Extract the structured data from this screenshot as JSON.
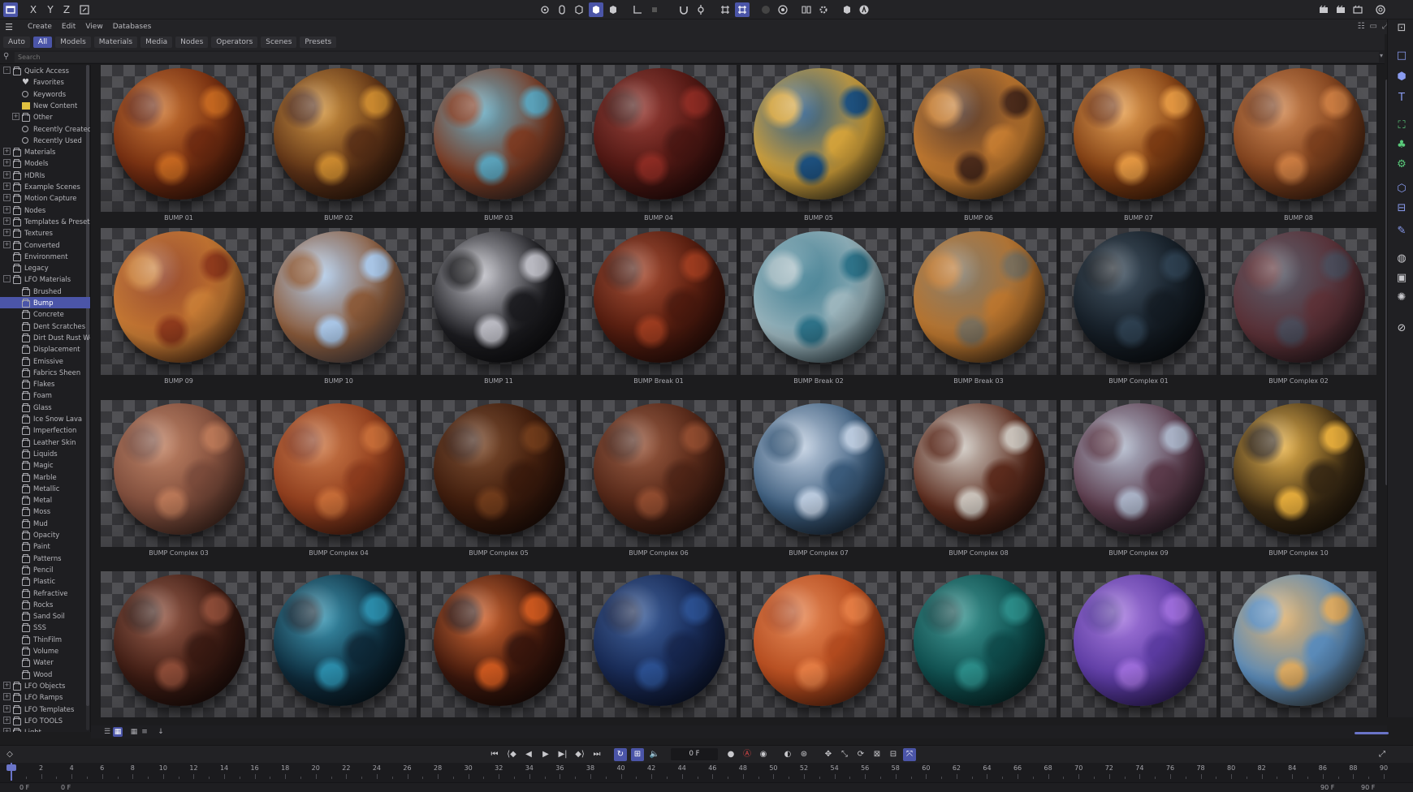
{
  "menu": {
    "items": [
      "Create",
      "Edit",
      "View",
      "Databases"
    ]
  },
  "axis_letters": [
    "X",
    "Y",
    "Z"
  ],
  "filters": {
    "tabs": [
      {
        "label": "Auto",
        "active": false
      },
      {
        "label": "All",
        "active": true
      },
      {
        "label": "Models",
        "active": false
      },
      {
        "label": "Materials",
        "active": false
      },
      {
        "label": "Media",
        "active": false
      },
      {
        "label": "Nodes",
        "active": false
      },
      {
        "label": "Operators",
        "active": false
      },
      {
        "label": "Scenes",
        "active": false
      },
      {
        "label": "Presets",
        "active": false
      }
    ]
  },
  "search": {
    "placeholder": "Search"
  },
  "tree": [
    {
      "label": "Quick Access",
      "depth": 0,
      "exp": "-",
      "icon": "folder"
    },
    {
      "label": "Favorites",
      "depth": 1,
      "exp": "",
      "icon": "heart"
    },
    {
      "label": "Keywords",
      "depth": 1,
      "exp": "",
      "icon": "search"
    },
    {
      "label": "New Content",
      "depth": 1,
      "exp": "",
      "icon": "star"
    },
    {
      "label": "Other",
      "depth": 1,
      "exp": "+",
      "icon": "folder"
    },
    {
      "label": "Recently Created",
      "depth": 1,
      "exp": "",
      "icon": "search"
    },
    {
      "label": "Recently Used",
      "depth": 1,
      "exp": "",
      "icon": "search"
    },
    {
      "label": "Materials",
      "depth": 0,
      "exp": "+",
      "icon": "folder"
    },
    {
      "label": "Models",
      "depth": 0,
      "exp": "+",
      "icon": "folder"
    },
    {
      "label": "HDRIs",
      "depth": 0,
      "exp": "+",
      "icon": "folder"
    },
    {
      "label": "Example Scenes",
      "depth": 0,
      "exp": "+",
      "icon": "folder"
    },
    {
      "label": "Motion Capture",
      "depth": 0,
      "exp": "+",
      "icon": "folder"
    },
    {
      "label": "Nodes",
      "depth": 0,
      "exp": "+",
      "icon": "folder"
    },
    {
      "label": "Templates & Presets",
      "depth": 0,
      "exp": "+",
      "icon": "folder"
    },
    {
      "label": "Textures",
      "depth": 0,
      "exp": "+",
      "icon": "folder"
    },
    {
      "label": "Converted",
      "depth": 0,
      "exp": "+",
      "icon": "folder"
    },
    {
      "label": "Environment",
      "depth": 0,
      "exp": "",
      "icon": "folder"
    },
    {
      "label": "Legacy",
      "depth": 0,
      "exp": "",
      "icon": "folder"
    },
    {
      "label": "LFO Materials",
      "depth": 0,
      "exp": "-",
      "icon": "folder"
    },
    {
      "label": "Brushed",
      "depth": 1,
      "exp": "",
      "icon": "folder"
    },
    {
      "label": "Bump",
      "depth": 1,
      "exp": "",
      "icon": "folder",
      "selected": true
    },
    {
      "label": "Concrete",
      "depth": 1,
      "exp": "",
      "icon": "folder"
    },
    {
      "label": "Dent Scratches",
      "depth": 1,
      "exp": "",
      "icon": "folder"
    },
    {
      "label": "Dirt Dust Rust Wet",
      "depth": 1,
      "exp": "",
      "icon": "folder"
    },
    {
      "label": "Displacement",
      "depth": 1,
      "exp": "",
      "icon": "folder"
    },
    {
      "label": "Emissive",
      "depth": 1,
      "exp": "",
      "icon": "folder"
    },
    {
      "label": "Fabrics Sheen",
      "depth": 1,
      "exp": "",
      "icon": "folder"
    },
    {
      "label": "Flakes",
      "depth": 1,
      "exp": "",
      "icon": "folder"
    },
    {
      "label": "Foam",
      "depth": 1,
      "exp": "",
      "icon": "folder"
    },
    {
      "label": "Glass",
      "depth": 1,
      "exp": "",
      "icon": "folder"
    },
    {
      "label": "Ice Snow Lava",
      "depth": 1,
      "exp": "",
      "icon": "folder"
    },
    {
      "label": "Imperfection",
      "depth": 1,
      "exp": "",
      "icon": "folder"
    },
    {
      "label": "Leather Skin",
      "depth": 1,
      "exp": "",
      "icon": "folder"
    },
    {
      "label": "Liquids",
      "depth": 1,
      "exp": "",
      "icon": "folder"
    },
    {
      "label": "Magic",
      "depth": 1,
      "exp": "",
      "icon": "folder"
    },
    {
      "label": "Marble",
      "depth": 1,
      "exp": "",
      "icon": "folder"
    },
    {
      "label": "Metallic",
      "depth": 1,
      "exp": "",
      "icon": "folder"
    },
    {
      "label": "Metal",
      "depth": 1,
      "exp": "",
      "icon": "folder"
    },
    {
      "label": "Moss",
      "depth": 1,
      "exp": "",
      "icon": "folder"
    },
    {
      "label": "Mud",
      "depth": 1,
      "exp": "",
      "icon": "folder"
    },
    {
      "label": "Opacity",
      "depth": 1,
      "exp": "",
      "icon": "folder"
    },
    {
      "label": "Paint",
      "depth": 1,
      "exp": "",
      "icon": "folder"
    },
    {
      "label": "Patterns",
      "depth": 1,
      "exp": "",
      "icon": "folder"
    },
    {
      "label": "Pencil",
      "depth": 1,
      "exp": "",
      "icon": "folder"
    },
    {
      "label": "Plastic",
      "depth": 1,
      "exp": "",
      "icon": "folder"
    },
    {
      "label": "Refractive",
      "depth": 1,
      "exp": "",
      "icon": "folder"
    },
    {
      "label": "Rocks",
      "depth": 1,
      "exp": "",
      "icon": "folder"
    },
    {
      "label": "Sand Soil",
      "depth": 1,
      "exp": "",
      "icon": "folder"
    },
    {
      "label": "SSS",
      "depth": 1,
      "exp": "",
      "icon": "folder"
    },
    {
      "label": "ThinFilm",
      "depth": 1,
      "exp": "",
      "icon": "folder"
    },
    {
      "label": "Volume",
      "depth": 1,
      "exp": "",
      "icon": "folder"
    },
    {
      "label": "Water",
      "depth": 1,
      "exp": "",
      "icon": "folder"
    },
    {
      "label": "Wood",
      "depth": 1,
      "exp": "",
      "icon": "folder"
    },
    {
      "label": "LFO Objects",
      "depth": 0,
      "exp": "+",
      "icon": "folder"
    },
    {
      "label": "LFO Ramps",
      "depth": 0,
      "exp": "+",
      "icon": "folder"
    },
    {
      "label": "LFO Templates",
      "depth": 0,
      "exp": "+",
      "icon": "folder"
    },
    {
      "label": "LFO TOOLS",
      "depth": 0,
      "exp": "+",
      "icon": "folder"
    },
    {
      "label": "Light",
      "depth": 0,
      "exp": "+",
      "icon": "folder"
    }
  ],
  "materials": [
    {
      "name": "BUMP 01",
      "c1": "#c2651f",
      "c2": "#6e2a10",
      "c3": "#1e0c06"
    },
    {
      "name": "BUMP 02",
      "c1": "#c8872e",
      "c2": "#5a3016",
      "c3": "#1a0e08"
    },
    {
      "name": "BUMP 03",
      "c1": "#5aa0b8",
      "c2": "#7a3a22",
      "c3": "#14242c"
    },
    {
      "name": "BUMP 04",
      "c1": "#8a2a22",
      "c2": "#4a1612",
      "c3": "#140606"
    },
    {
      "name": "BUMP 05",
      "c1": "#1d4f7c",
      "c2": "#d0a03a",
      "c3": "#08121e"
    },
    {
      "name": "BUMP 06",
      "c1": "#4a2a1a",
      "c2": "#c27a30",
      "c3": "#0c0806"
    },
    {
      "name": "BUMP 07",
      "c1": "#e09440",
      "c2": "#7a3a12",
      "c3": "#2a1206"
    },
    {
      "name": "BUMP 08",
      "c1": "#c87a40",
      "c2": "#7a3e1c",
      "c3": "#20100a"
    },
    {
      "name": "BUMP 09",
      "c1": "#8e3a1c",
      "c2": "#c67a34",
      "c3": "#1e0a06"
    },
    {
      "name": "BUMP 10",
      "c1": "#a8c4e4",
      "c2": "#8a5a3a",
      "c3": "#3a4458"
    },
    {
      "name": "BUMP 11",
      "c1": "#b8b8c0",
      "c2": "#1c1c20",
      "c3": "#08080a"
    },
    {
      "name": "BUMP Break 01",
      "c1": "#9a3a1e",
      "c2": "#4e1a0e",
      "c3": "#160806"
    },
    {
      "name": "BUMP Break 02",
      "c1": "#2e7288",
      "c2": "#9ab4bc",
      "c3": "#0a1c24"
    },
    {
      "name": "BUMP Break 03",
      "c1": "#7a6e5a",
      "c2": "#b8742e",
      "c3": "#141210"
    },
    {
      "name": "BUMP Complex 01",
      "c1": "#2c3e4e",
      "c2": "#141c24",
      "c3": "#06080a"
    },
    {
      "name": "BUMP Complex 02",
      "c1": "#4a4a58",
      "c2": "#5a3036",
      "c3": "#101014"
    },
    {
      "name": "BUMP Complex 03",
      "c1": "#b87656",
      "c2": "#7a4a3a",
      "c3": "#2a1a14"
    },
    {
      "name": "BUMP Complex 04",
      "c1": "#c46a36",
      "c2": "#8a3a1c",
      "c3": "#2a100a"
    },
    {
      "name": "BUMP Complex 05",
      "c1": "#6e3a1a",
      "c2": "#3a1a0c",
      "c3": "#0c0604"
    },
    {
      "name": "BUMP Complex 06",
      "c1": "#8e4a2e",
      "c2": "#4e2416",
      "c3": "#160a06"
    },
    {
      "name": "BUMP Complex 07",
      "c1": "#b8c8dc",
      "c2": "#3a5a7a",
      "c3": "#0a0e14"
    },
    {
      "name": "BUMP Complex 08",
      "c1": "#c8c0b8",
      "c2": "#5a2a1c",
      "c3": "#0e0806"
    },
    {
      "name": "BUMP Complex 09",
      "c1": "#a8b0c4",
      "c2": "#5a3a4a",
      "c3": "#0e0e14"
    },
    {
      "name": "BUMP Complex 10",
      "c1": "#e0a83a",
      "c2": "#3a2a14",
      "c3": "#0c0804"
    },
    {
      "name": "",
      "c1": "#8a4a36",
      "c2": "#3a1a12",
      "c3": "#0c0606"
    },
    {
      "name": "",
      "c1": "#2a8aa8",
      "c2": "#0e2a3a",
      "c3": "#040a0e"
    },
    {
      "name": "",
      "c1": "#c8561e",
      "c2": "#3a160c",
      "c3": "#0a0604"
    },
    {
      "name": "",
      "c1": "#2a4e8e",
      "c2": "#16264e",
      "c3": "#060a18"
    },
    {
      "name": "",
      "c1": "#e27a42",
      "c2": "#b24a1e",
      "c3": "#3a1408"
    },
    {
      "name": "",
      "c1": "#2a8a86",
      "c2": "#0e4a4a",
      "c3": "#041818"
    },
    {
      "name": "",
      "c1": "#9a6ad8",
      "c2": "#5a3aa0",
      "c3": "#1c1040"
    },
    {
      "name": "",
      "c1": "#d8a862",
      "c2": "#5a8ab8",
      "c3": "#3a2a14"
    }
  ],
  "timeline": {
    "frame": "0 F",
    "ticks": [
      "0",
      "2",
      "4",
      "6",
      "8",
      "10",
      "12",
      "14",
      "16",
      "18",
      "20",
      "22",
      "24",
      "26",
      "28",
      "30",
      "32",
      "34",
      "36",
      "38",
      "40",
      "42",
      "44",
      "46",
      "48",
      "50",
      "52",
      "54",
      "56",
      "58",
      "60",
      "62",
      "64",
      "66",
      "68",
      "70",
      "72",
      "74",
      "76",
      "78",
      "80",
      "82",
      "84",
      "86",
      "88",
      "90"
    ],
    "start_left": "0 F",
    "start_right": "0 F",
    "end_left": "90 F",
    "end_right": "90 F"
  }
}
